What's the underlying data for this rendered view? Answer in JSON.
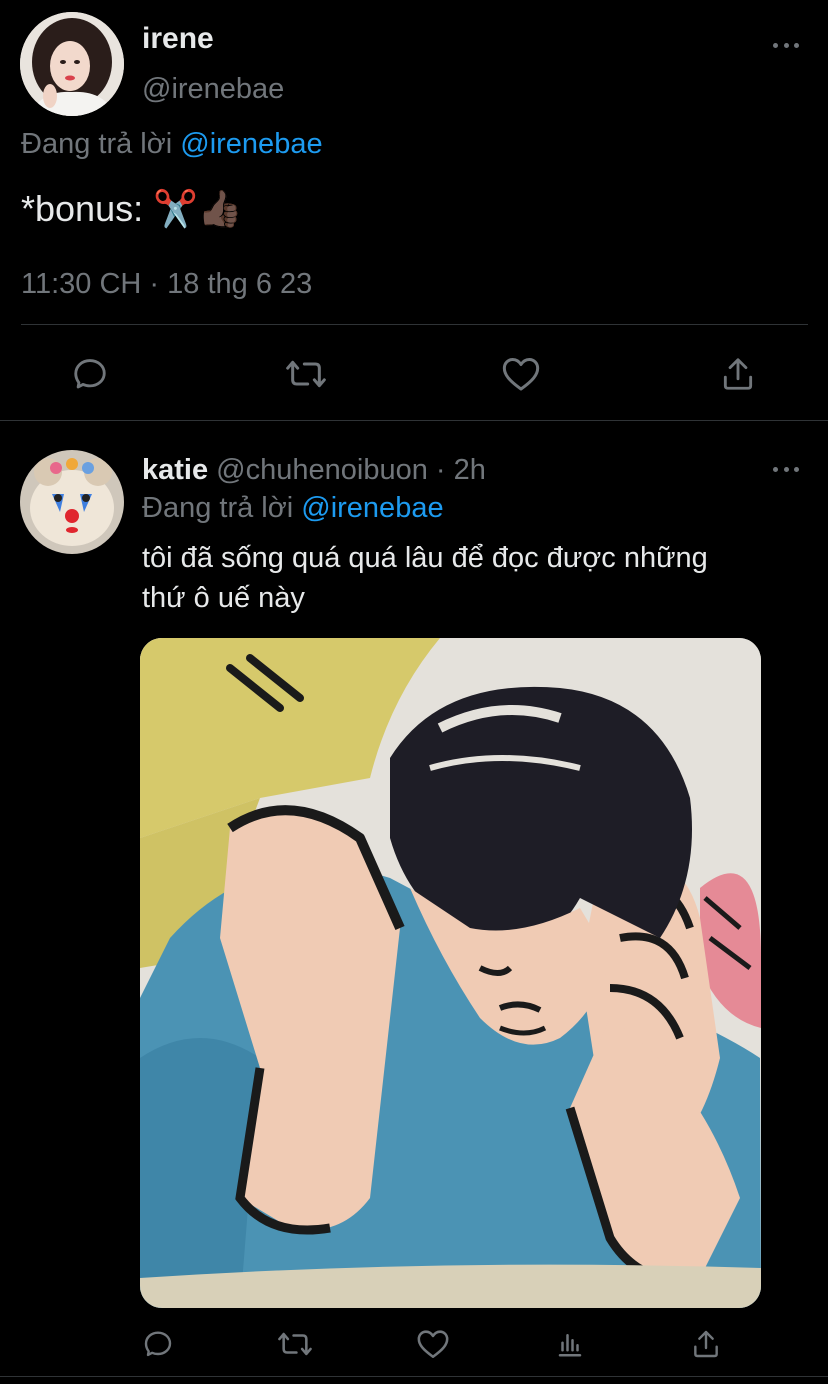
{
  "main_tweet": {
    "display_name": "irene",
    "handle": "@irenebae",
    "reply_prefix": "Đang trả lời",
    "reply_to": "@irenebae",
    "text": "*bonus: ✂️👍🏿",
    "timestamp": "11:30 CH · 18 thg 6 23"
  },
  "reply_tweet": {
    "display_name": "katie",
    "handle": "@chuhenoibuon",
    "time": "· 2h",
    "reply_prefix": "Đang trả lời",
    "reply_to": "@irenebae",
    "text_line1": "tôi đã sống quá quá lâu để đọc được những",
    "text_line2": "thứ ô uế này"
  },
  "colors": {
    "background": "#000000",
    "text": "#e7e9ea",
    "muted": "#71767b",
    "accent": "#1d9bf0",
    "divider": "#2f3336"
  },
  "icons": {
    "actions_main": [
      "reply-icon",
      "retweet-icon",
      "like-icon",
      "share-icon"
    ],
    "actions_reply": [
      "reply-icon",
      "retweet-icon",
      "like-icon",
      "views-icon",
      "share-icon"
    ]
  }
}
